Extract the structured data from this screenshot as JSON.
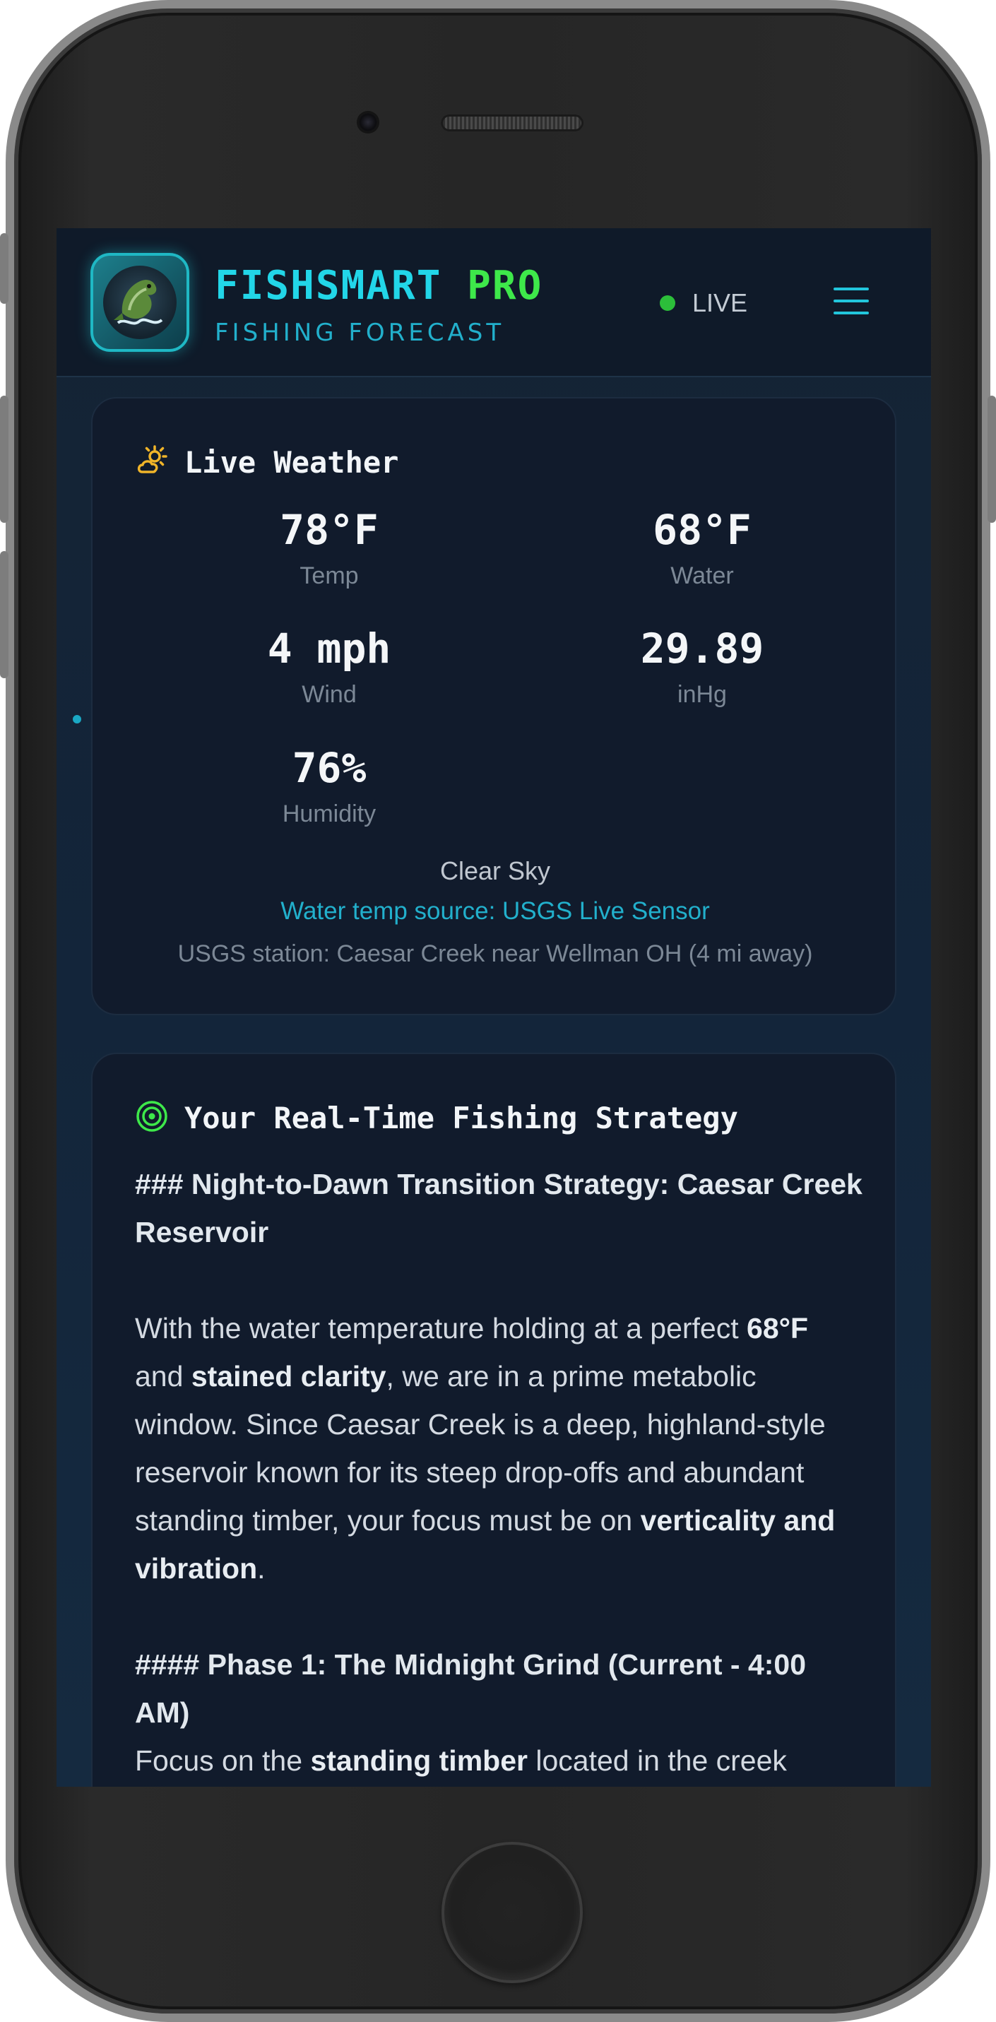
{
  "header": {
    "brand_part1": "FISHSMART",
    "brand_part2": "PRO",
    "subtitle": "FISHING FORECAST",
    "status": "LIVE"
  },
  "weather": {
    "title": "Live Weather",
    "metrics": [
      {
        "value": "78°F",
        "label": "Temp"
      },
      {
        "value": "68°F",
        "label": "Water"
      },
      {
        "value": "4 mph",
        "label": "Wind"
      },
      {
        "value": "29.89",
        "label": "inHg"
      },
      {
        "value": "76%",
        "label": "Humidity"
      }
    ],
    "condition": "Clear Sky",
    "water_source": "Water temp source: USGS Live Sensor",
    "station": "USGS station: Caesar Creek near Wellman OH (4 mi away)"
  },
  "strategy": {
    "title": "Your Real-Time Fishing Strategy",
    "heading1_prefix": "###",
    "heading1": "Night-to-Dawn Transition Strategy: Caesar Creek Reservoir",
    "para1_a": "With the water temperature holding at a perfect ",
    "para1_b": "68°F",
    "para1_c": " and ",
    "para1_d": "stained clarity",
    "para1_e": ", we are in a prime metabolic window. Since Caesar Creek is a deep, highland-style reservoir known for its steep drop-offs and abundant standing timber, your focus must be on ",
    "para1_f": "verticality and vibration",
    "para1_g": ".",
    "heading2_prefix": "####",
    "heading2": "Phase 1: The Midnight Grind (Current - 4:00 AM)",
    "para2_a": "Focus on the ",
    "para2_b": "standing timber",
    "para2_c": " located in the creek"
  },
  "colors": {
    "accent_cyan": "#22d6e8",
    "accent_green": "#3ee84a",
    "live_dot": "#2cbf3a",
    "card_bg": "#111b2c"
  }
}
